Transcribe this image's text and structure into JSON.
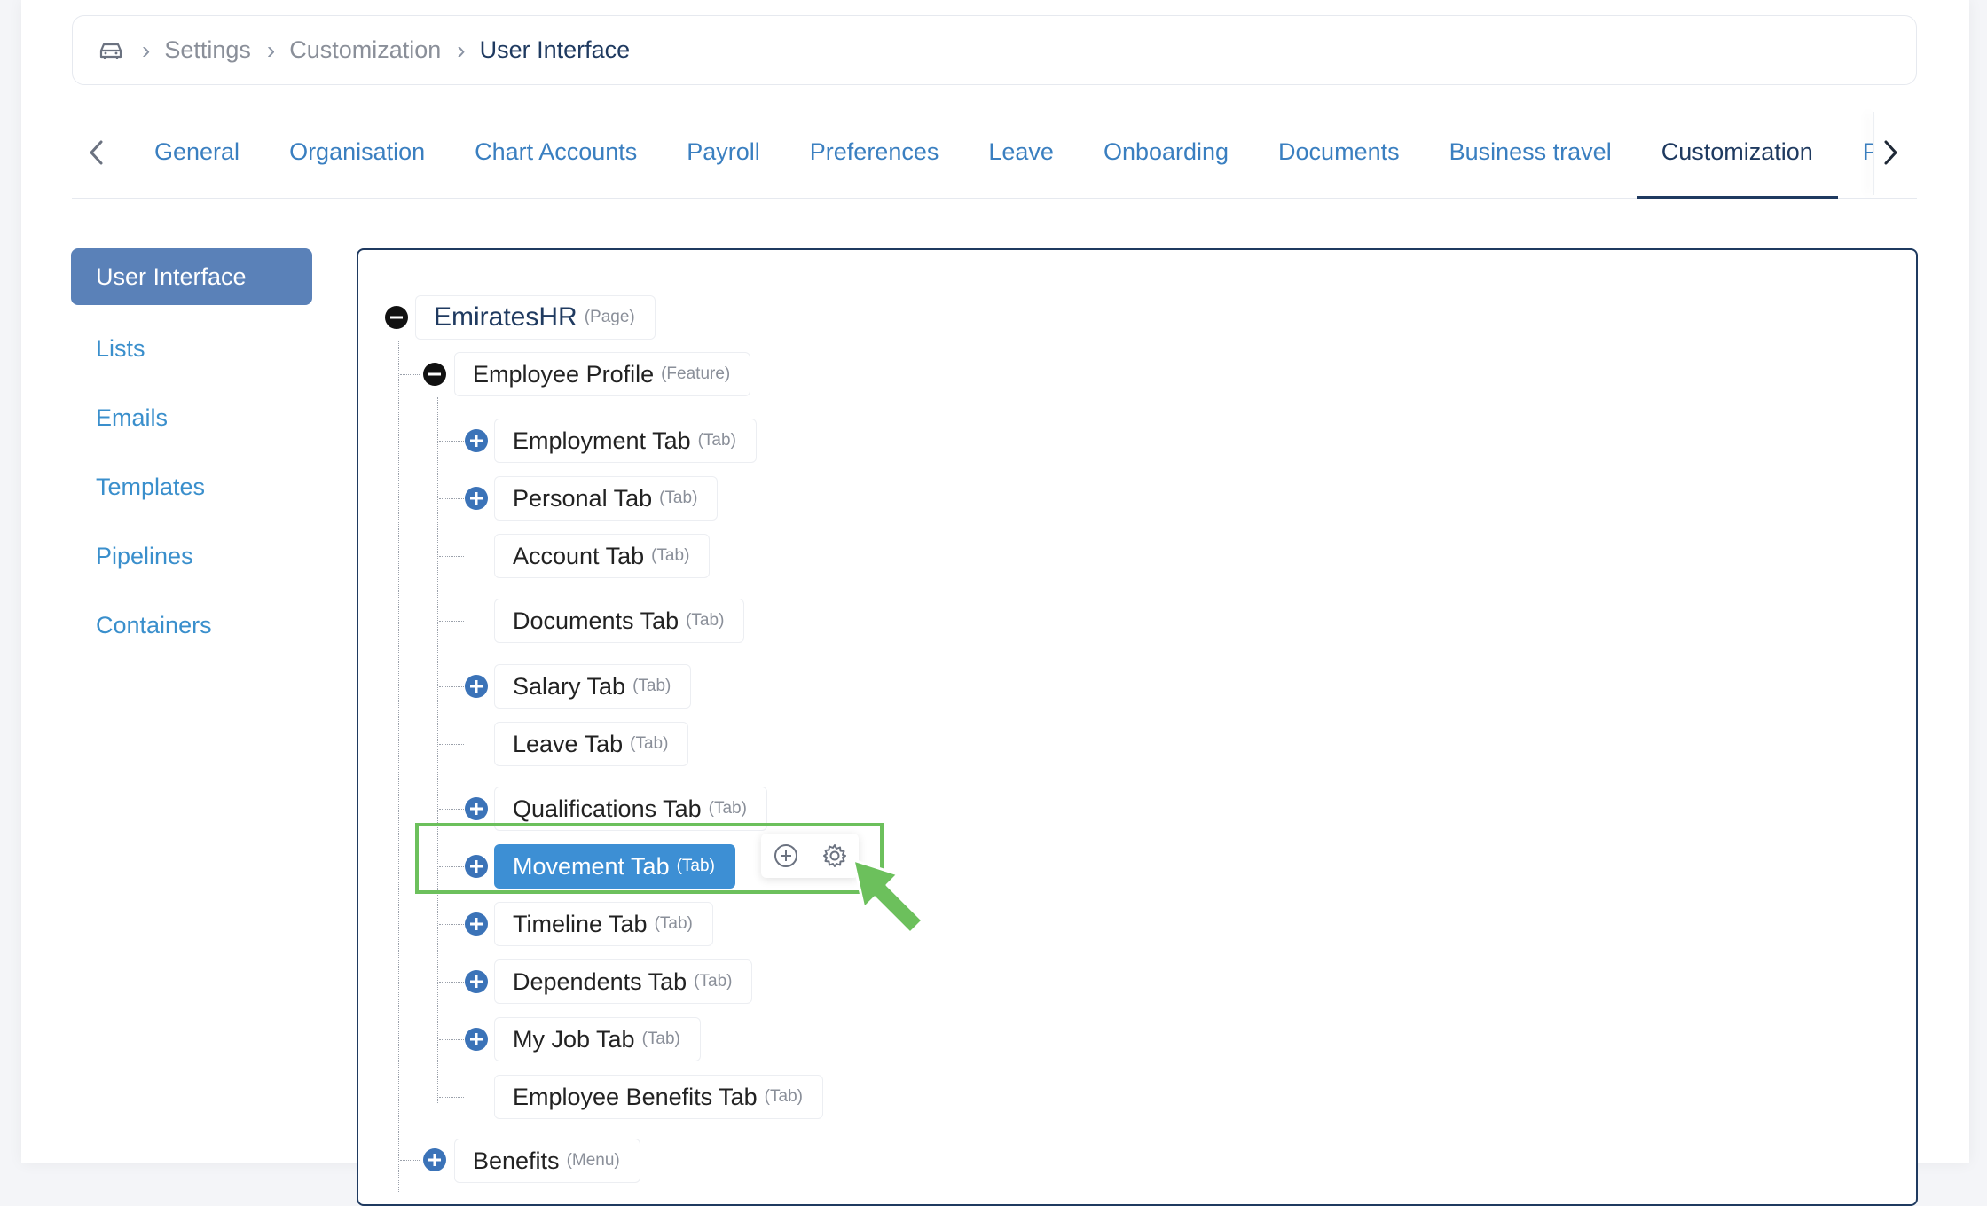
{
  "breadcrumb": {
    "home_icon": "car-icon",
    "items": [
      "Settings",
      "Customization"
    ],
    "current": "User Interface"
  },
  "tabs": {
    "items": [
      "General",
      "Organisation",
      "Chart Accounts",
      "Payroll",
      "Preferences",
      "Leave",
      "Onboarding",
      "Documents",
      "Business travel",
      "Customization",
      "Po"
    ],
    "active": "Customization"
  },
  "sidebar": {
    "items": [
      "User Interface",
      "Lists",
      "Emails",
      "Templates",
      "Pipelines",
      "Containers"
    ],
    "active": "User Interface"
  },
  "tree": {
    "root": {
      "name": "EmiratesHR",
      "type": "(Page)"
    },
    "feature": {
      "name": "Employee Profile",
      "type": "(Feature)"
    },
    "tabs": [
      {
        "name": "Employment Tab",
        "type": "(Tab)",
        "expandable": true
      },
      {
        "name": "Personal Tab",
        "type": "(Tab)",
        "expandable": true
      },
      {
        "name": "Account Tab",
        "type": "(Tab)",
        "expandable": false
      },
      {
        "name": "Documents Tab",
        "type": "(Tab)",
        "expandable": false
      },
      {
        "name": "Salary Tab",
        "type": "(Tab)",
        "expandable": true
      },
      {
        "name": "Leave Tab",
        "type": "(Tab)",
        "expandable": false
      },
      {
        "name": "Qualifications Tab",
        "type": "(Tab)",
        "expandable": true
      },
      {
        "name": "Movement Tab",
        "type": "(Tab)",
        "expandable": true
      },
      {
        "name": "Timeline Tab",
        "type": "(Tab)",
        "expandable": true
      },
      {
        "name": "Dependents Tab",
        "type": "(Tab)",
        "expandable": true
      },
      {
        "name": "My Job Tab",
        "type": "(Tab)",
        "expandable": true
      },
      {
        "name": "Employee Benefits Tab",
        "type": "(Tab)",
        "expandable": false
      }
    ],
    "menu": {
      "name": "Benefits",
      "type": "(Menu)"
    },
    "selected": "Movement Tab",
    "actions": [
      "add-circle-icon",
      "gear-icon"
    ]
  },
  "colors": {
    "accent": "#3d8fd4",
    "navy": "#1f3a60",
    "link": "#3a7fc0",
    "highlight": "#6cc05c"
  }
}
